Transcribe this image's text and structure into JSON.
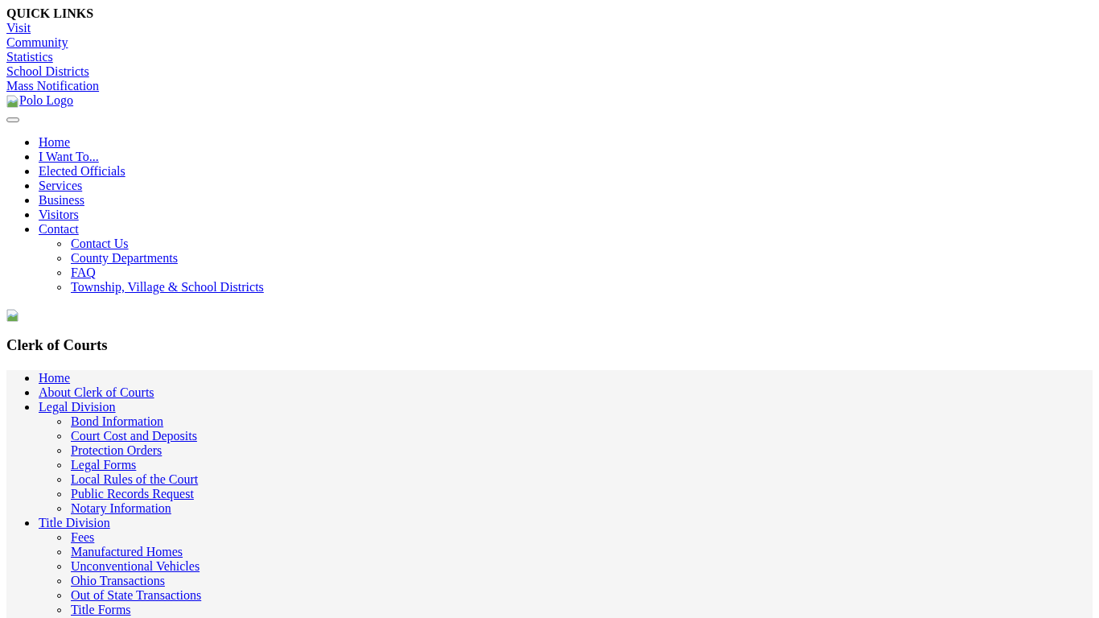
{
  "quick_links": {
    "title": "QUICK LINKS",
    "links": [
      "Visit",
      "Community",
      "Statistics",
      "School Districts",
      "Mass Notification"
    ]
  },
  "logo": {
    "alt": "Polo Logo"
  },
  "main_nav": [
    {
      "label": "Home"
    },
    {
      "label": "I Want To..."
    },
    {
      "label": "Elected Officials"
    },
    {
      "label": "Services"
    },
    {
      "label": "Business"
    },
    {
      "label": "Visitors"
    },
    {
      "label": "Contact",
      "children": [
        {
          "label": "Contact Us"
        },
        {
          "label": "County Departments"
        },
        {
          "label": "FAQ"
        },
        {
          "label": "Township, Village & School Districts"
        }
      ]
    }
  ],
  "page_title": "Clerk of Courts",
  "side_nav": [
    {
      "label": "Home"
    },
    {
      "label": "About Clerk of Courts"
    },
    {
      "label": "Legal Division",
      "children": [
        {
          "label": "Bond Information"
        },
        {
          "label": "Court Cost and Deposits"
        },
        {
          "label": "Protection Orders"
        },
        {
          "label": "Legal Forms"
        },
        {
          "label": "Local Rules of the Court"
        },
        {
          "label": "Public Records Request"
        },
        {
          "label": "Notary Information"
        }
      ]
    },
    {
      "label": "Title Division",
      "children": [
        {
          "label": "Fees"
        },
        {
          "label": "Manufactured Homes"
        },
        {
          "label": "Unconventional Vehicles"
        },
        {
          "label": "Ohio Transactions"
        },
        {
          "label": "Out of State Transactions"
        },
        {
          "label": "Title Forms"
        }
      ]
    }
  ]
}
